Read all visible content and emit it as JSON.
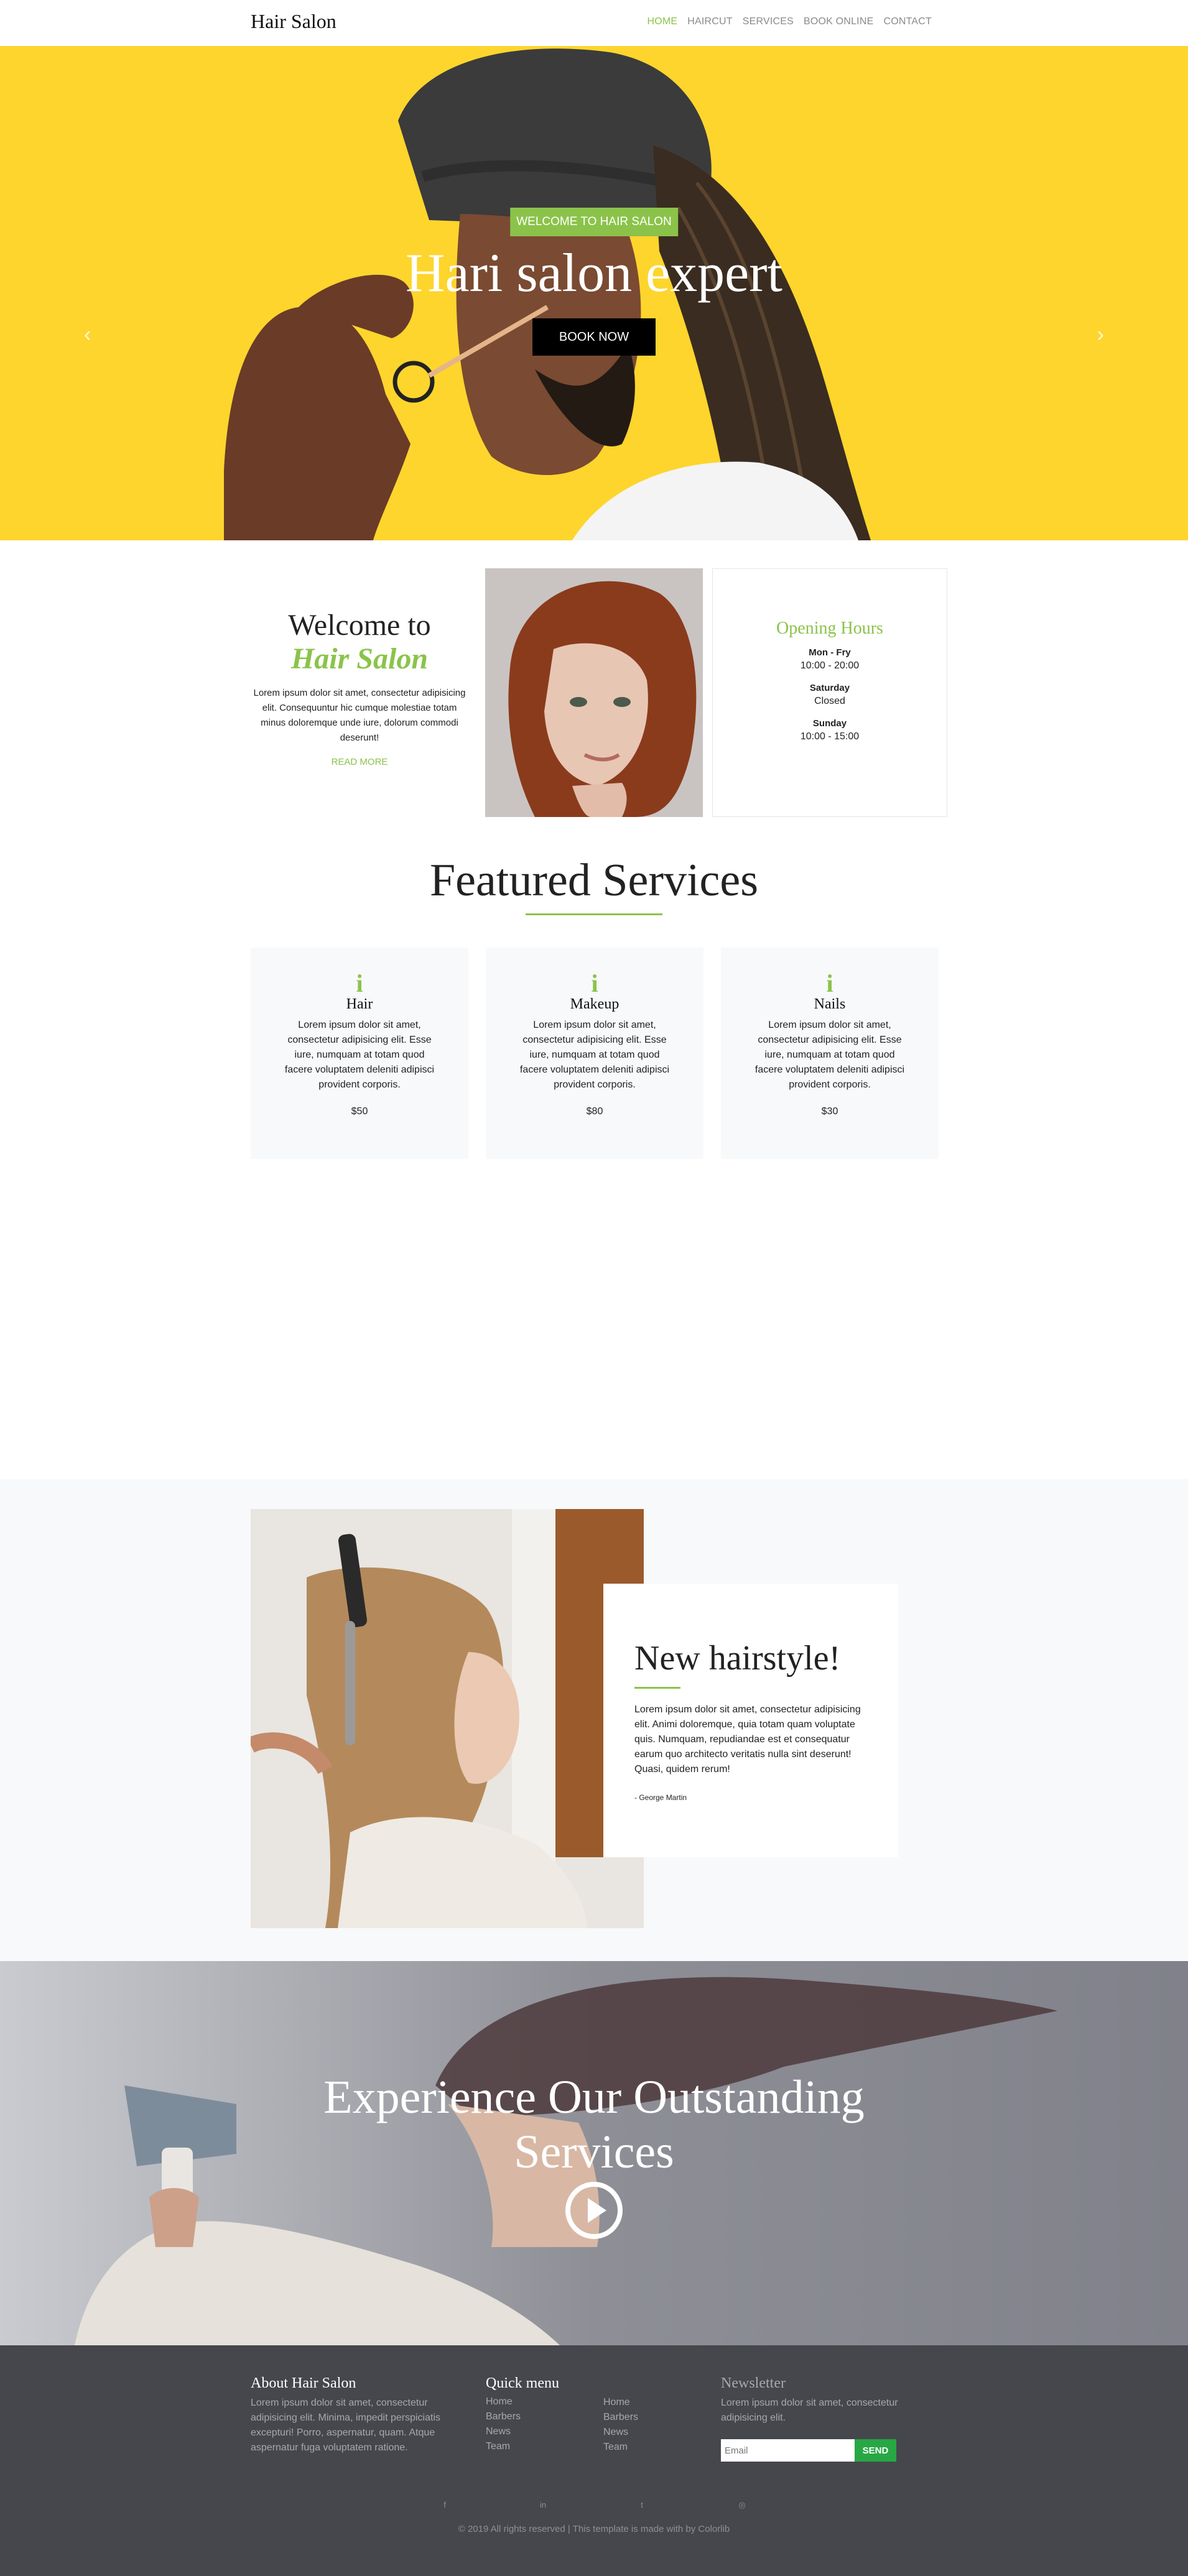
{
  "nav": {
    "brand": "Hair Salon",
    "items": [
      "HOME",
      "HAIRCUT",
      "SERVICES",
      "BOOK ONLINE",
      "CONTACT"
    ]
  },
  "hero": {
    "tag": "WELCOME TO HAIR SALON",
    "title": "Hari salon expert",
    "button": "BOOK NOW",
    "prev_icon": "chevron-left-icon",
    "next_icon": "chevron-right-icon"
  },
  "welcome": {
    "title_line1": "Welcome to",
    "title_line2": "Hair Salon",
    "text": "Lorem ipsum dolor sit amet, consectetur adipisicing elit. Consequuntur hic cumque molestiae totam minus doloremque unde iure, dolorum commodi deserunt!",
    "read_more": "READ MORE"
  },
  "hours": {
    "title": "Opening Hours",
    "rows": [
      {
        "day": "Mon - Fry",
        "time": "10:00 - 20:00"
      },
      {
        "day": "Saturday",
        "time": "Closed"
      },
      {
        "day": "Sunday",
        "time": "10:00 - 15:00"
      }
    ]
  },
  "featured": {
    "title": "Featured Services",
    "services": [
      {
        "icon": "i",
        "name": "Hair",
        "text": "Lorem ipsum dolor sit amet, consectetur adipisicing elit. Esse iure, numquam at totam quod facere voluptatem deleniti adipisci provident corporis.",
        "price": "$50"
      },
      {
        "icon": "i",
        "name": "Makeup",
        "text": "Lorem ipsum dolor sit amet, consectetur adipisicing elit. Esse iure, numquam at totam quod facere voluptatem deleniti adipisci provident corporis.",
        "price": "$80"
      },
      {
        "icon": "i",
        "name": "Nails",
        "text": "Lorem ipsum dolor sit amet, consectetur adipisicing elit. Esse iure, numquam at totam quod facere voluptatem deleniti adipisci provident corporis.",
        "price": "$30"
      }
    ]
  },
  "new_hairstyle": {
    "title": "New hairstyle!",
    "text": "Lorem ipsum dolor sit amet, consectetur adipisicing elit. Animi doloremque, quia totam quam voluptate quis. Numquam, repudiandae est et consequatur earum quo architecto veritatis nulla sint deserunt! Quasi, quidem rerum!",
    "author": "- George Martin"
  },
  "experience": {
    "title_line1": "Experience Our Outstanding",
    "title_line2": "Services",
    "play_icon": "play-circle-icon"
  },
  "footer": {
    "about_title": "About Hair Salon",
    "about_text": "Lorem ipsum dolor sit amet, consectetur adipisicing elit. Minima, impedit perspiciatis excepturi! Porro, aspernatur, quam. Atque aspernatur fuga voluptatem ratione.",
    "quick_title": "Quick menu",
    "quick_links_a": [
      "Home",
      "Barbers",
      "News",
      "Team"
    ],
    "quick_links_b": [
      "Home",
      "Barbers",
      "News",
      "Team"
    ],
    "newsletter_title": "Newsletter",
    "newsletter_text": "Lorem ipsum dolor sit amet, consectetur adipisicing elit.",
    "email_placeholder": "Email",
    "send_label": "SEND",
    "social_icons": [
      "facebook-icon",
      "linkedin-icon",
      "twitter-icon",
      "instagram-icon"
    ],
    "copyright": "© 2019 All rights reserved | This template is made with by Colorlib"
  }
}
